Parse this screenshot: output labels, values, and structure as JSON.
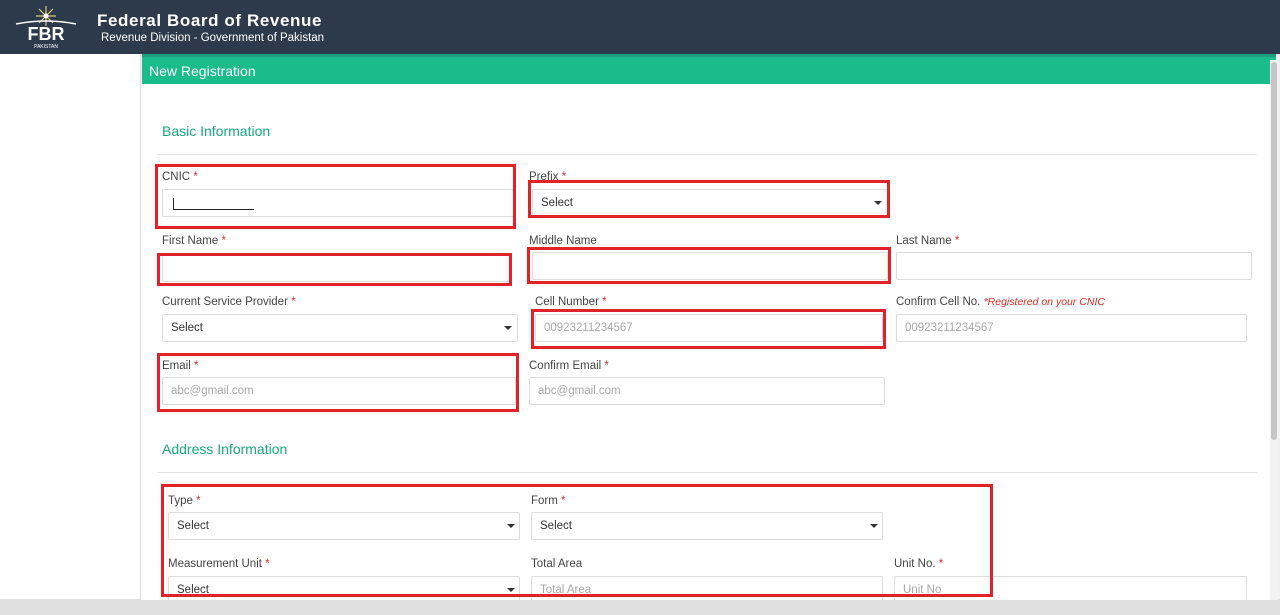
{
  "header": {
    "logo_text": "FBR",
    "logo_sub": "PAKISTAN",
    "title": "Federal Board of Revenue",
    "subtitle": "Revenue Division - Government of Pakistan"
  },
  "card": {
    "title": "New Registration"
  },
  "basic": {
    "section_title": "Basic Information",
    "cnic_label": "CNIC",
    "prefix_label": "Prefix",
    "prefix_value": "Select",
    "first_name_label": "First Name",
    "middle_name_label": "Middle Name",
    "last_name_label": "Last Name",
    "provider_label": "Current Service Provider",
    "provider_value": "Select",
    "cell_label": "Cell Number",
    "cell_placeholder": "00923211234567",
    "confirm_cell_label": "Confirm Cell No.",
    "confirm_cell_note": "*Registered on your CNIC",
    "confirm_cell_placeholder": "00923211234567",
    "email_label": "Email",
    "email_placeholder": "abc@gmail.com",
    "confirm_email_label": "Confirm Email",
    "confirm_email_placeholder": "abc@gmail.com",
    "required_mark": "*"
  },
  "address": {
    "section_title": "Address Information",
    "type_label": "Type",
    "type_value": "Select",
    "form_label": "Form",
    "form_value": "Select",
    "measurement_label": "Measurement Unit",
    "measurement_value": "Select",
    "total_area_label": "Total Area",
    "total_area_placeholder": "Total Area",
    "unit_no_label": "Unit No.",
    "unit_no_placeholder": "Unit No",
    "required_mark": "*"
  },
  "colors": {
    "topbar": "#2d3a4b",
    "header_green": "#1abc8c",
    "section_green": "#18a97f",
    "required_red": "#d9312b",
    "highlight_red": "#e02229"
  },
  "icons": [
    "fbr-logo-icon",
    "chevron-down-icon"
  ]
}
